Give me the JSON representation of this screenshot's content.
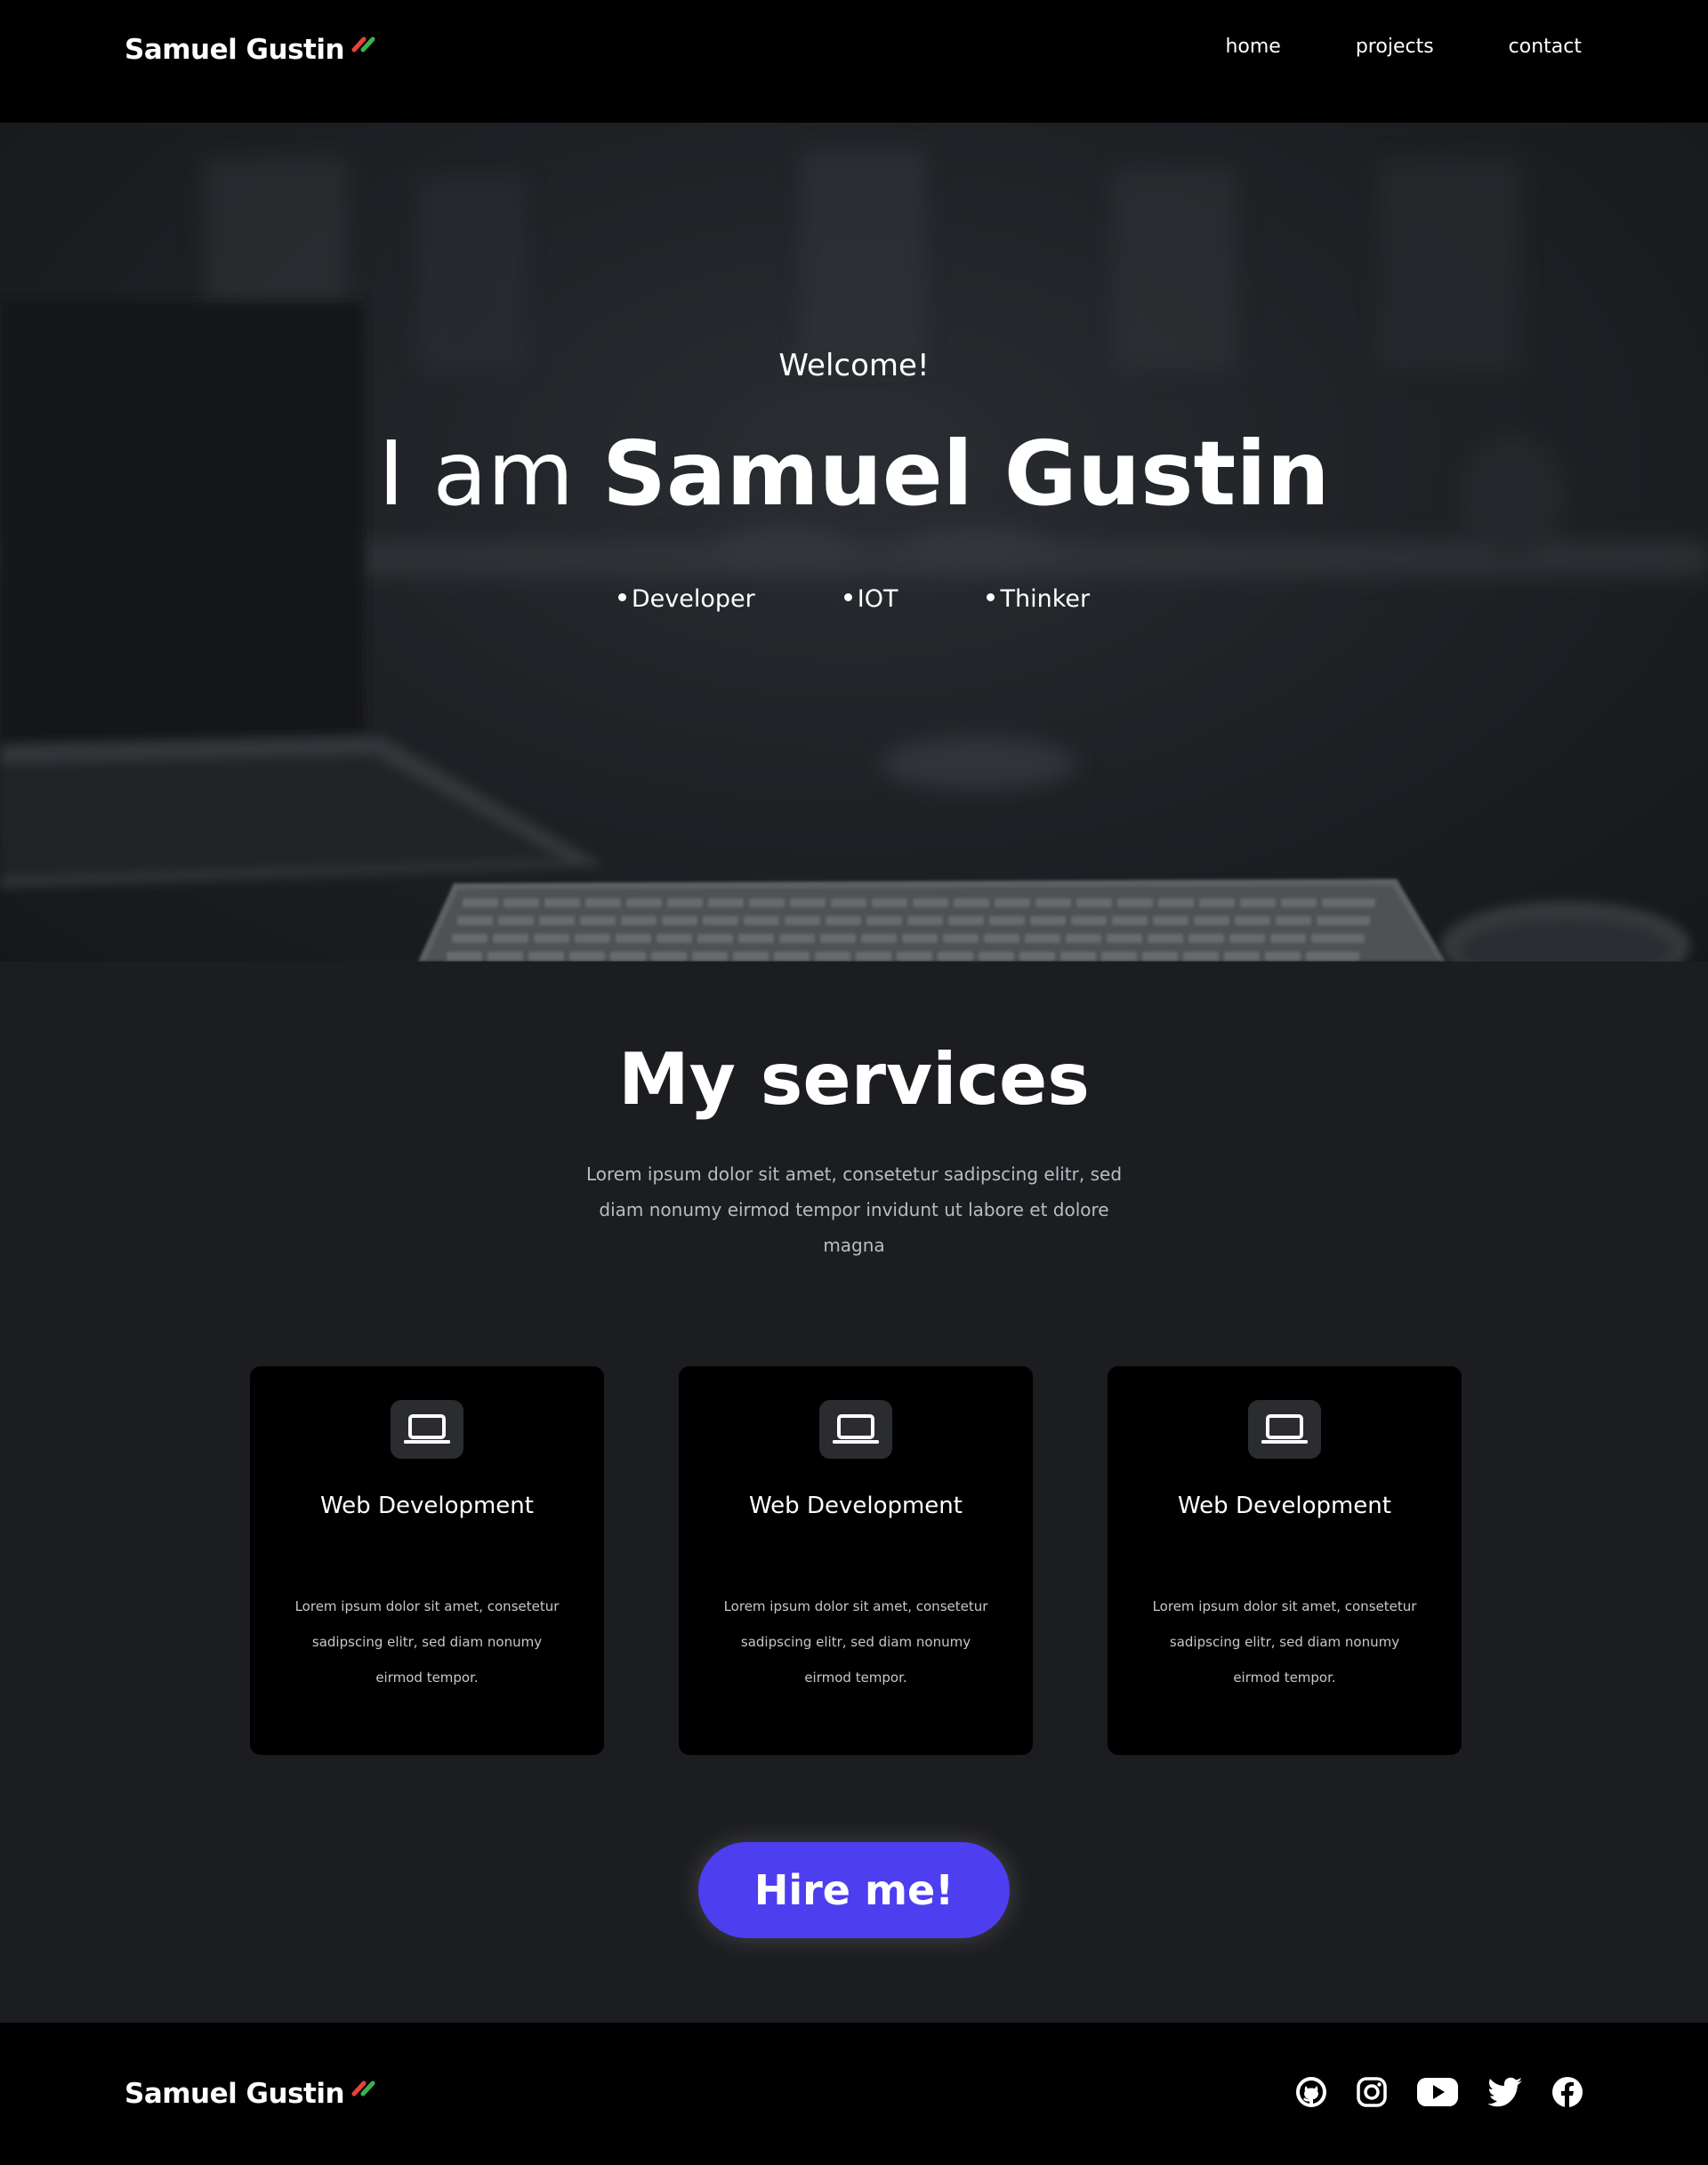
{
  "header": {
    "brand": "Samuel Gustin",
    "nav": [
      {
        "label": "home"
      },
      {
        "label": "projects"
      },
      {
        "label": "contact"
      }
    ]
  },
  "hero": {
    "welcome": "Welcome!",
    "title_prefix": "I am ",
    "title_name": "Samuel Gustin",
    "roles": [
      "Developer",
      "IOT",
      "Thinker"
    ]
  },
  "services": {
    "title": "My services",
    "description": "Lorem ipsum dolor sit amet, consetetur sadipscing elitr, sed diam nonumy eirmod tempor invidunt ut labore et dolore magna",
    "cards": [
      {
        "icon": "laptop-icon",
        "title": "Web Development",
        "description": "Lorem ipsum dolor sit amet, consetetur sadipscing elitr, sed diam nonumy eirmod tempor."
      },
      {
        "icon": "laptop-icon",
        "title": "Web Development",
        "description": "Lorem ipsum dolor sit amet, consetetur sadipscing elitr, sed diam nonumy eirmod tempor."
      },
      {
        "icon": "laptop-icon",
        "title": "Web Development",
        "description": "Lorem ipsum dolor sit amet, consetetur sadipscing elitr, sed diam nonumy eirmod tempor."
      }
    ],
    "cta": "Hire me!"
  },
  "footer": {
    "brand": "Samuel Gustin",
    "socials": [
      "github-icon",
      "instagram-icon",
      "youtube-icon",
      "twitter-icon",
      "facebook-icon"
    ]
  },
  "colors": {
    "accent": "#4d3ef0",
    "brand_mark_red": "#e8413a",
    "brand_mark_green": "#3cb24a",
    "page_bg": "#1c1d21",
    "card_bg": "#000000"
  }
}
